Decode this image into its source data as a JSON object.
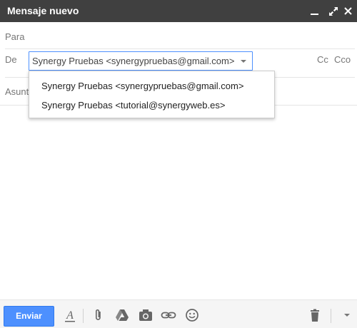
{
  "window": {
    "title": "Mensaje nuevo",
    "controls": [
      "minimize-icon",
      "expand-icon",
      "close-icon"
    ]
  },
  "recipients": {
    "to_label": "Para",
    "from_label": "De",
    "from_value": "Synergy Pruebas <synergypruebas@gmail.com>",
    "cc_label": "Cc",
    "bcc_label": "Cco"
  },
  "from_dropdown": {
    "options": [
      "Synergy Pruebas <synergypruebas@gmail.com>",
      "Synergy Pruebas <tutorial@synergyweb.es>"
    ]
  },
  "subject": {
    "placeholder": "Asunto"
  },
  "toolbar": {
    "send_label": "Enviar",
    "icons": [
      "format-text-icon",
      "attach-icon",
      "drive-icon",
      "photo-icon",
      "link-icon",
      "emoji-icon",
      "trash-icon",
      "more-options-icon"
    ]
  },
  "colors": {
    "titlebar": "#404040",
    "accent": "#4d90fe"
  }
}
